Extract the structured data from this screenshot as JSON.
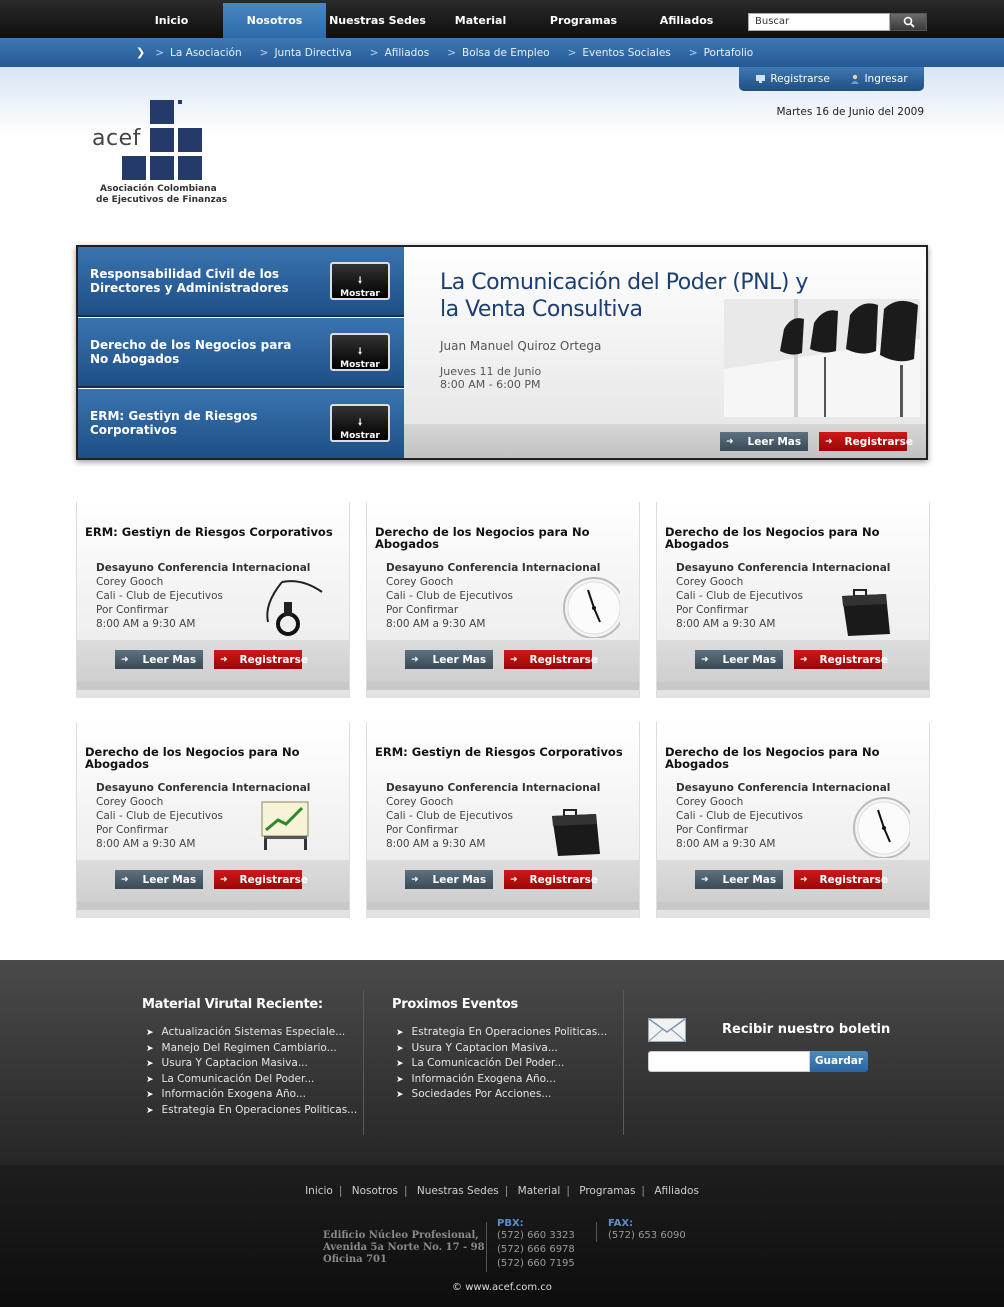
{
  "top_nav": {
    "items": [
      "Inicio",
      "Nosotros",
      "Nuestras Sedes",
      "Material",
      "Programas",
      "Afiliados"
    ],
    "active": "Nosotros",
    "active_color": "#3a7bbd"
  },
  "search": {
    "value": "Buscar",
    "icon": "search-icon"
  },
  "sub_nav": {
    "items": [
      "La Asociación",
      "Junta Directiva",
      "Afiliados",
      "Bolsa de Empleo",
      "Eventos Sociales",
      "Portafolio"
    ]
  },
  "user_links": {
    "register": "Registrarse",
    "login": "Ingresar"
  },
  "date": "Martes 16 de Junio del 2009",
  "logo": {
    "name": "acef",
    "tagline_1": "Asociación Colombiana",
    "tagline_2": "de Ejecutivos de Finanzas",
    "color": "#243a6b"
  },
  "slider": {
    "slides": [
      {
        "title": "Responsabilidad Civil de los Directores y Administradores",
        "button": "Mostrar"
      },
      {
        "title": "Derecho de los Negocios para No Abogados",
        "button": "Mostrar"
      },
      {
        "title": "ERM: Gestiyn de Riesgos Corporativos",
        "button": "Mostrar"
      }
    ],
    "feature": {
      "title": "La Comunicación del Poder (PNL) y la Venta Consultiva",
      "speaker": "Juan Manuel Quiroz Ortega",
      "date": "Jueves 11 de Junio",
      "time": "8:00 AM - 6:00 PM",
      "more": "Leer Mas",
      "register": "Registrarse"
    }
  },
  "cards": [
    {
      "title": "ERM: Gestiyn de Riesgos Corporativos",
      "type": "Desayuno Conferencia Internacional",
      "speaker": "Corey Gooch",
      "place": "Cali - Club de Ejecutivos",
      "status": "Por Confirmar",
      "time": "8:00 AM a 9:30 AM",
      "image": "stethoscope-icon",
      "more": "Leer Mas",
      "register": "Registrarse"
    },
    {
      "title": "Derecho de los Negocios para No Abogados",
      "type": "Desayuno Conferencia Internacional",
      "speaker": "Corey Gooch",
      "place": "Cali - Club de Ejecutivos",
      "status": "Por Confirmar",
      "time": "8:00 AM a 9:30 AM",
      "image": "clock-icon",
      "more": "Leer Mas",
      "register": "Registrarse"
    },
    {
      "title": "Derecho de los Negocios para No Abogados",
      "type": "Desayuno Conferencia Internacional",
      "speaker": "Corey Gooch",
      "place": "Cali - Club de Ejecutivos",
      "status": "Por Confirmar",
      "time": "8:00 AM a 9:30 AM",
      "image": "briefcase-icon",
      "more": "Leer Mas",
      "register": "Registrarse"
    },
    {
      "title": "Derecho de los Negocios para No Abogados",
      "type": "Desayuno Conferencia Internacional",
      "speaker": "Corey Gooch",
      "place": "Cali - Club de Ejecutivos",
      "status": "Por Confirmar",
      "time": "8:00 AM a 9:30 AM",
      "image": "chart-board-icon",
      "more": "Leer Mas",
      "register": "Registrarse"
    },
    {
      "title": "ERM: Gestiyn de Riesgos Corporativos",
      "type": "Desayuno Conferencia Internacional",
      "speaker": "Corey Gooch",
      "place": "Cali - Club de Ejecutivos",
      "status": "Por Confirmar",
      "time": "8:00 AM a 9:30 AM",
      "image": "briefcase-icon",
      "more": "Leer Mas",
      "register": "Registrarse"
    },
    {
      "title": "Derecho de los Negocios para No Abogados",
      "type": "Desayuno Conferencia Internacional",
      "speaker": "Corey Gooch",
      "place": "Cali - Club de Ejecutivos",
      "status": "Por Confirmar",
      "time": "8:00 AM a 9:30 AM",
      "image": "clock-icon",
      "more": "Leer Mas",
      "register": "Registrarse"
    }
  ],
  "footer": {
    "material": {
      "title": "Material Virutal Reciente:",
      "items": [
        "Actualización Sistemas Especiale...",
        "Manejo Del Regimen Cambiario...",
        "Usura Y Captacion Masiva...",
        "La Comunicación Del Poder...",
        "Información Exogena Año...",
        "Estrategia En Operaciones Politicas..."
      ]
    },
    "events": {
      "title": "Proximos Eventos",
      "items": [
        "Estrategia En Operaciones Politicas...",
        "Usura Y Captacion Masiva...",
        "La Comunicación Del Poder...",
        "Información Exogena Año...",
        "Sociedades Por Acciones..."
      ]
    },
    "newsletter": {
      "title": "Recibir nuestro boletin",
      "button": "Guardar",
      "value": ""
    },
    "nav": [
      "Inicio",
      "Nosotros",
      "Nuestras Sedes",
      "Material",
      "Programas",
      "Afiliados"
    ],
    "address": [
      "Edificio Núcleo Profesional,",
      "Avenida 5a Norte No. 17 - 98",
      "Oficina 701"
    ],
    "pbx_label": "PBX:",
    "pbx": [
      "(572) 660 3323",
      "(572) 666 6978",
      "(572) 660 7195"
    ],
    "fax_label": "FAX:",
    "fax": "(572) 653 6090",
    "copyright": "© www.acef.com.co"
  }
}
